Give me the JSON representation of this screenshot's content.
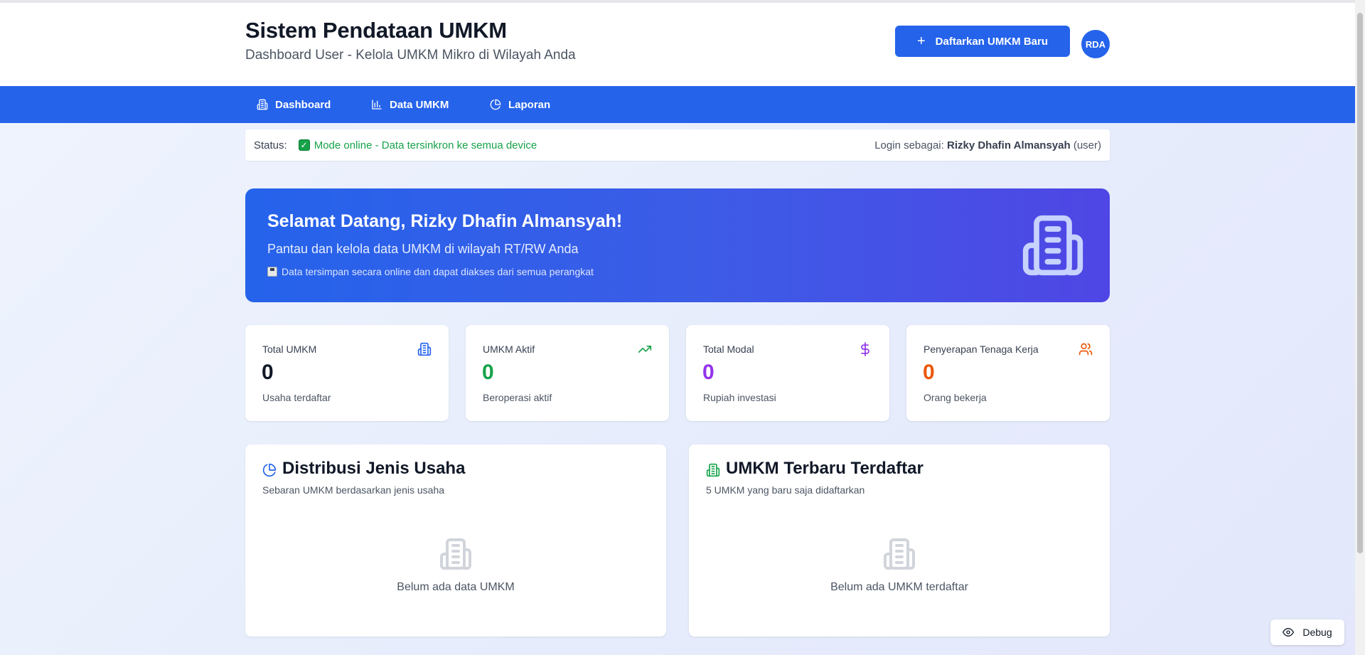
{
  "header": {
    "title": "Sistem Pendataan UMKM",
    "subtitle": "Dashboard User - Kelola UMKM Mikro di Wilayah Anda",
    "register_label": "Daftarkan UMKM Baru",
    "register_icon": "plus-icon",
    "avatar_initials": "RDA"
  },
  "nav": {
    "items": [
      {
        "label": "Dashboard",
        "icon": "building-icon"
      },
      {
        "label": "Data UMKM",
        "icon": "bar-chart-icon"
      },
      {
        "label": "Laporan",
        "icon": "pie-chart-icon"
      }
    ]
  },
  "status": {
    "label": "Status:",
    "icon": "check-icon",
    "text": "Mode online - Data tersinkron ke semua device",
    "login_prefix": "Login sebagai:",
    "login_name": "Rizky Dhafin Almansyah",
    "login_role": "(user)"
  },
  "hero": {
    "title": "Selamat Datang, Rizky Dhafin Almansyah!",
    "subtitle": "Pantau dan kelola data UMKM di wilayah RT/RW Anda",
    "note_icon": "floppy-disk-icon",
    "note": "Data tersimpan secara online dan dapat diakses dari semua perangkat",
    "icon": "building-icon"
  },
  "stats": [
    {
      "label": "Total UMKM",
      "value": "0",
      "sub": "Usaha terdaftar",
      "icon": "building-icon",
      "color": "#111827",
      "icon_color": "#2563eb"
    },
    {
      "label": "UMKM Aktif",
      "value": "0",
      "sub": "Beroperasi aktif",
      "icon": "trending-up-icon",
      "color": "#16a34a",
      "icon_color": "#16a34a"
    },
    {
      "label": "Total Modal",
      "value": "0",
      "sub": "Rupiah investasi",
      "icon": "dollar-icon",
      "color": "#9333ea",
      "icon_color": "#9333ea"
    },
    {
      "label": "Penyerapan Tenaga Kerja",
      "value": "0",
      "sub": "Orang bekerja",
      "icon": "users-icon",
      "color": "#ea580c",
      "icon_color": "#ea580c"
    }
  ],
  "panels": {
    "distribution": {
      "title": "Distribusi Jenis Usaha",
      "subtitle": "Sebaran UMKM berdasarkan jenis usaha",
      "empty": "Belum ada data UMKM",
      "icon": "pie-chart-icon"
    },
    "latest": {
      "title": "UMKM Terbaru Terdaftar",
      "subtitle": "5 UMKM yang baru saja didaftarkan",
      "empty": "Belum ada UMKM terdaftar",
      "icon": "building-icon"
    }
  },
  "debug": {
    "label": "Debug",
    "icon": "eye-icon"
  }
}
